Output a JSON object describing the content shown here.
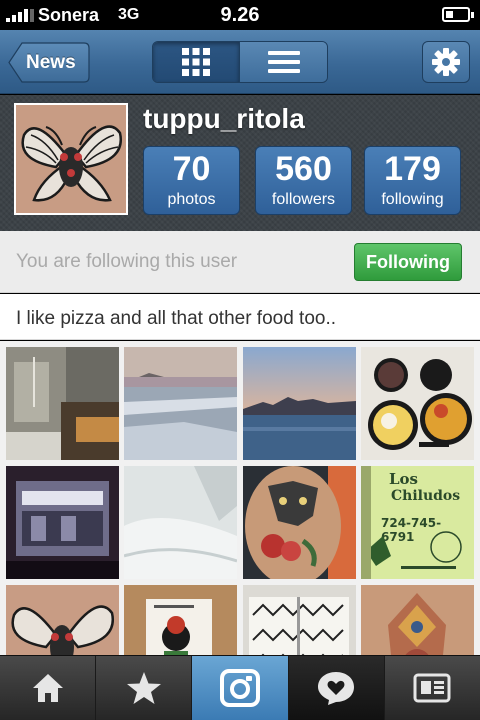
{
  "status_bar": {
    "carrier": "Sonera",
    "network": "3G",
    "time": "9.26"
  },
  "navbar": {
    "back_label": "News",
    "views": [
      "grid-view-icon",
      "list-view-icon"
    ],
    "settings_icon": "gear-icon"
  },
  "profile": {
    "username": "tuppu_ritola",
    "stats": [
      {
        "number": "70",
        "label": "photos"
      },
      {
        "number": "560",
        "label": "followers"
      },
      {
        "number": "179",
        "label": "following"
      }
    ]
  },
  "follow": {
    "status_text": "You are following this user",
    "button_label": "Following"
  },
  "bio": "I like pizza and all that other food too..",
  "photos": {
    "sign_title": "Los",
    "sign_title2": "Chiludos",
    "sign_phone": "724-745-6791"
  },
  "tabbar": {
    "tabs": [
      "home-icon",
      "star-icon",
      "camera-icon",
      "news-icon",
      "profile-icon"
    ]
  },
  "colors": {
    "nav_blue": "#3a6896",
    "stat_blue": "#2f6099",
    "following_green": "#2f9b3c"
  }
}
